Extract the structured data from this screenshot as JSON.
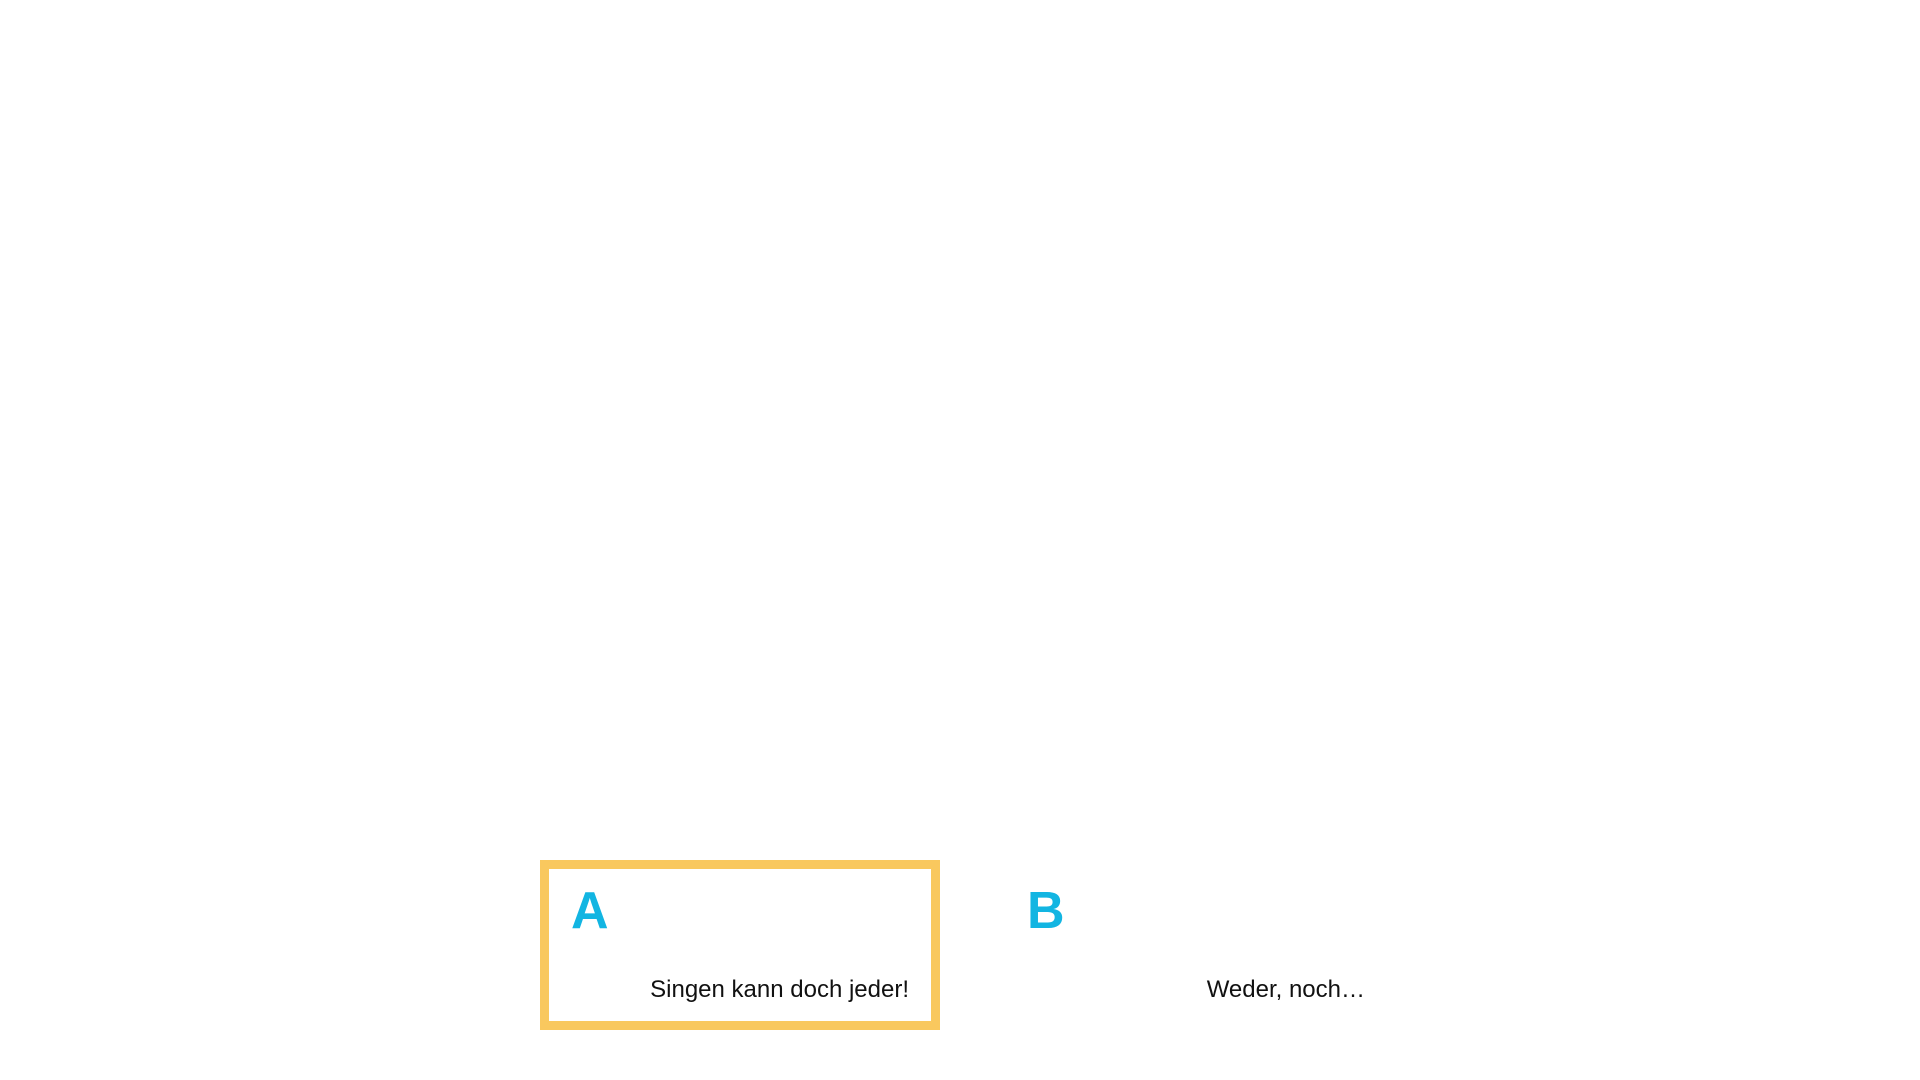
{
  "colors": {
    "background": "#ffffff",
    "selected_border": "#F9C85E",
    "letter": "#12B5E2",
    "text": "#111111"
  },
  "options": [
    {
      "letter": "A",
      "text": "Singen kann doch jeder!",
      "selected": true
    },
    {
      "letter": "B",
      "text": "Weder, noch…",
      "selected": false
    }
  ]
}
